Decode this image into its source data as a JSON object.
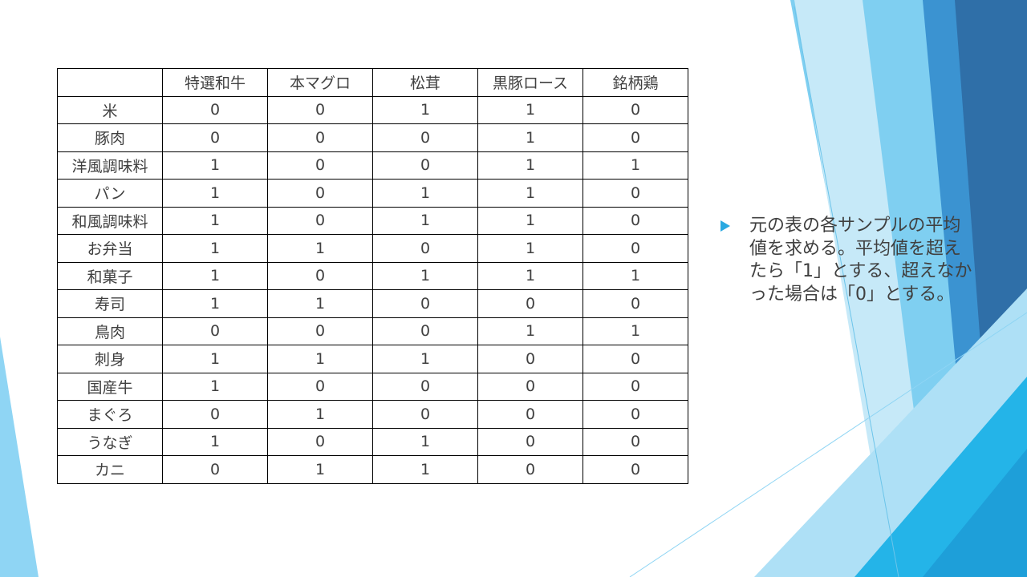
{
  "table": {
    "headers": [
      "",
      "特選和牛",
      "本マグロ",
      "松茸",
      "黒豚ロース",
      "銘柄鶏"
    ],
    "rows": [
      {
        "label": "米",
        "values": [
          "0",
          "0",
          "1",
          "1",
          "0"
        ]
      },
      {
        "label": "豚肉",
        "values": [
          "0",
          "0",
          "0",
          "1",
          "0"
        ]
      },
      {
        "label": "洋風調味料",
        "values": [
          "1",
          "0",
          "0",
          "1",
          "1"
        ]
      },
      {
        "label": "パン",
        "values": [
          "1",
          "0",
          "1",
          "1",
          "0"
        ]
      },
      {
        "label": "和風調味料",
        "values": [
          "1",
          "0",
          "1",
          "1",
          "0"
        ]
      },
      {
        "label": "お弁当",
        "values": [
          "1",
          "1",
          "0",
          "1",
          "0"
        ]
      },
      {
        "label": "和菓子",
        "values": [
          "1",
          "0",
          "1",
          "1",
          "1"
        ]
      },
      {
        "label": "寿司",
        "values": [
          "1",
          "1",
          "0",
          "0",
          "0"
        ]
      },
      {
        "label": "鳥肉",
        "values": [
          "0",
          "0",
          "0",
          "1",
          "1"
        ]
      },
      {
        "label": "刺身",
        "values": [
          "1",
          "1",
          "1",
          "0",
          "0"
        ]
      },
      {
        "label": "国産牛",
        "values": [
          "1",
          "0",
          "0",
          "0",
          "0"
        ]
      },
      {
        "label": "まぐろ",
        "values": [
          "0",
          "1",
          "0",
          "0",
          "0"
        ]
      },
      {
        "label": "うなぎ",
        "values": [
          "1",
          "0",
          "1",
          "0",
          "0"
        ]
      },
      {
        "label": "カニ",
        "values": [
          "0",
          "1",
          "1",
          "0",
          "0"
        ]
      }
    ]
  },
  "note": {
    "text": "元の表の各サンプルの平均値を求める。平均値を超えたら「1」とする、超えなかった場合は「0」とする。",
    "bullet_icon": "triangle-bullet-icon"
  },
  "theme": {
    "accent": "#29a9e1",
    "dark_blue": "#2e75b6",
    "light_blue": "#7ecdf0",
    "text": "#404040"
  }
}
